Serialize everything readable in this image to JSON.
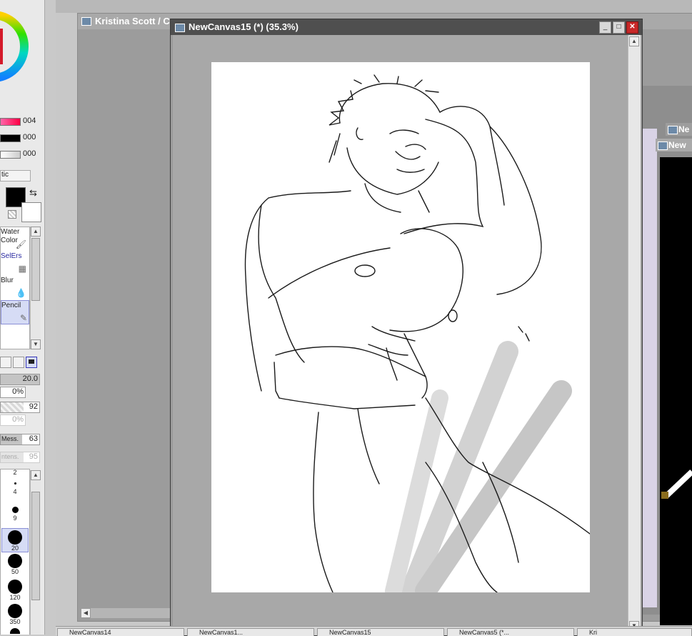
{
  "color_panel": {
    "slider_values": [
      "004",
      "000",
      "000"
    ]
  },
  "mode_label": "tic",
  "tools": [
    {
      "label": "Water\nColor",
      "icon": "brush-icon"
    },
    {
      "label": "SelErs",
      "icon": "eraser-icon"
    },
    {
      "label": "Blur",
      "icon": "drop-icon"
    },
    {
      "label": "Pencil",
      "icon": "pencil-icon"
    }
  ],
  "params": {
    "brush_size": "20.0",
    "min_size": "0%",
    "density": "92",
    "min_density": "0%",
    "mix_label": "Mess.",
    "mix_value": "63",
    "intens_label": "ntens.",
    "intens_value": "95"
  },
  "brush_sizes": [
    "2",
    "4",
    "9",
    "20",
    "50",
    "120",
    "350"
  ],
  "selected_brush_size": "20",
  "windows": {
    "front_title": "NewCanvas15 (*) (35.3%)",
    "back_title": "Kristina Scott / C",
    "right_window_1": "Ne",
    "right_window_2": "New"
  },
  "taskbar": [
    "NewCanvas14",
    "NewCanvas1...",
    "NewCanvas15",
    "NewCanvas5 (*...",
    "Kri"
  ]
}
